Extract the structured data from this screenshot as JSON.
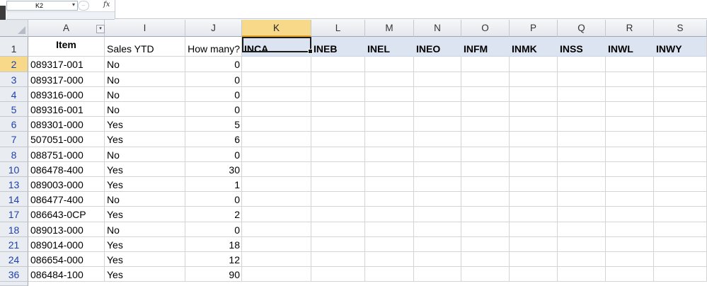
{
  "namebox": {
    "value": "K2"
  },
  "formula_bar": {
    "fx_label": "fx",
    "content": ""
  },
  "columns": [
    "A",
    "I",
    "J",
    "K",
    "L",
    "M",
    "N",
    "O",
    "P",
    "Q",
    "R",
    "S"
  ],
  "selected_column": "K",
  "header_row": {
    "row_number": "1",
    "item": "Item",
    "sales_ytd": "Sales YTD",
    "how_many": "How many?",
    "codes": [
      "INCA",
      "INEB",
      "INEL",
      "INEO",
      "INFM",
      "INMK",
      "INSS",
      "INWL",
      "INWY"
    ]
  },
  "rows": [
    {
      "row_number": "2",
      "item": "089317-001",
      "sales": "No",
      "qty": "0"
    },
    {
      "row_number": "3",
      "item": "089317-000",
      "sales": "No",
      "qty": "0"
    },
    {
      "row_number": "4",
      "item": "089316-000",
      "sales": "No",
      "qty": "0"
    },
    {
      "row_number": "5",
      "item": "089316-001",
      "sales": "No",
      "qty": "0"
    },
    {
      "row_number": "6",
      "item": "089301-000",
      "sales": "Yes",
      "qty": "5"
    },
    {
      "row_number": "7",
      "item": "507051-000",
      "sales": "Yes",
      "qty": "6"
    },
    {
      "row_number": "8",
      "item": "088751-000",
      "sales": "No",
      "qty": "0"
    },
    {
      "row_number": "10",
      "item": "086478-400",
      "sales": "Yes",
      "qty": "30"
    },
    {
      "row_number": "13",
      "item": "089003-000",
      "sales": "Yes",
      "qty": "1"
    },
    {
      "row_number": "14",
      "item": "086477-400",
      "sales": "No",
      "qty": "0"
    },
    {
      "row_number": "17",
      "item": "086643-0CP",
      "sales": "Yes",
      "qty": "2"
    },
    {
      "row_number": "18",
      "item": "089013-000",
      "sales": "No",
      "qty": "0"
    },
    {
      "row_number": "21",
      "item": "089014-000",
      "sales": "Yes",
      "qty": "18"
    },
    {
      "row_number": "24",
      "item": "086654-000",
      "sales": "Yes",
      "qty": "12"
    },
    {
      "row_number": "36",
      "item": "086484-100",
      "sales": "Yes",
      "qty": "90"
    }
  ],
  "colors": {
    "header_fill": "#dce3f1",
    "selected_header": "#f8d98a"
  }
}
